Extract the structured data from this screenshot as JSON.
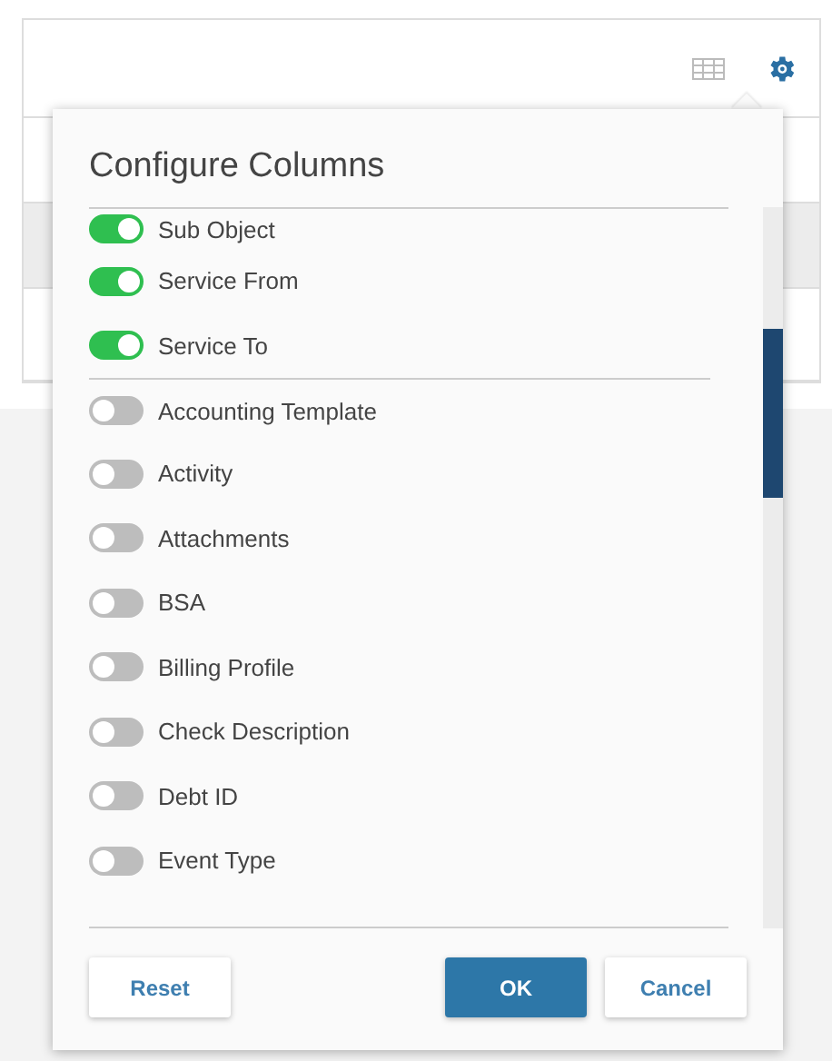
{
  "toolbar": {
    "grid_view": {
      "selected": false
    },
    "settings": {
      "selected": true
    }
  },
  "dialog": {
    "title": "Configure Columns",
    "groups": [
      {
        "items": [
          {
            "label": "Sub Object",
            "on": true
          },
          {
            "label": "Service From",
            "on": true
          },
          {
            "label": "Service To",
            "on": true
          }
        ]
      },
      {
        "items": [
          {
            "label": "Accounting Template",
            "on": false
          },
          {
            "label": "Activity",
            "on": false
          },
          {
            "label": "Attachments",
            "on": false
          },
          {
            "label": "BSA",
            "on": false
          },
          {
            "label": "Billing Profile",
            "on": false
          },
          {
            "label": "Check Description",
            "on": false
          },
          {
            "label": "Debt ID",
            "on": false
          },
          {
            "label": "Event Type",
            "on": false
          }
        ]
      }
    ],
    "buttons": [
      {
        "label": "Reset",
        "kind": "secondary"
      },
      {
        "label": "OK",
        "kind": "primary"
      },
      {
        "label": "Cancel",
        "kind": "secondary"
      }
    ]
  }
}
